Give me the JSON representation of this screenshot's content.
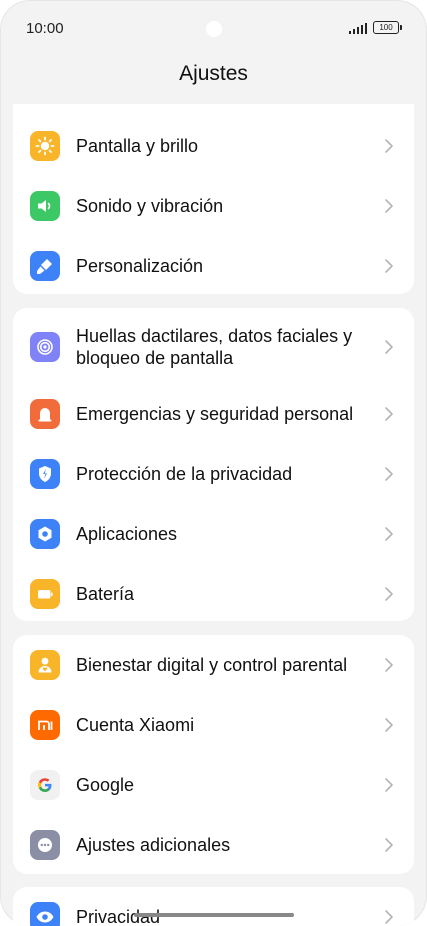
{
  "status_bar": {
    "time": "10:00",
    "battery": "100"
  },
  "header": {
    "title": "Ajustes"
  },
  "sections": [
    {
      "items": [
        {
          "name": "display",
          "label": "Pantalla y brillo",
          "icon": "sun-icon",
          "color": "#F9B52A"
        },
        {
          "name": "sound",
          "label": "Sonido y vibración",
          "icon": "speaker-icon",
          "color": "#3CC864"
        },
        {
          "name": "personalization",
          "label": "Personalización",
          "icon": "brush-icon",
          "color": "#3D82F6"
        }
      ]
    },
    {
      "items": [
        {
          "name": "fingerprint",
          "label": "Huellas dactilares, datos faciales y bloqueo de pantalla",
          "icon": "fingerprint-icon",
          "color": "#7F83F7"
        },
        {
          "name": "emergency",
          "label": "Emergencias y seguridad personal",
          "icon": "siren-icon",
          "color": "#F26B3A"
        },
        {
          "name": "privacy-protection",
          "label": "Protección de la privacidad",
          "icon": "shield-icon",
          "color": "#3D82F6"
        },
        {
          "name": "apps",
          "label": "Aplicaciones",
          "icon": "hexagon-gear-icon",
          "color": "#3D82F6"
        },
        {
          "name": "battery",
          "label": "Batería",
          "icon": "battery-icon",
          "color": "#F9B52A"
        }
      ]
    },
    {
      "items": [
        {
          "name": "wellbeing",
          "label": "Bienestar digital y control parental",
          "icon": "person-heart-icon",
          "color": "#F9B52A"
        },
        {
          "name": "xiaomi-account",
          "label": "Cuenta Xiaomi",
          "icon": "mi-logo-icon",
          "color": "#FF6A00"
        },
        {
          "name": "google",
          "label": "Google",
          "icon": "google-g-icon",
          "color": "#F1F1F1"
        },
        {
          "name": "additional",
          "label": "Ajustes adicionales",
          "icon": "more-dots-icon",
          "color": "#8A8FA6"
        }
      ]
    },
    {
      "items": [
        {
          "name": "privacy",
          "label": "Privacidad",
          "icon": "eye-icon",
          "color": "#3D82F6"
        }
      ]
    }
  ]
}
